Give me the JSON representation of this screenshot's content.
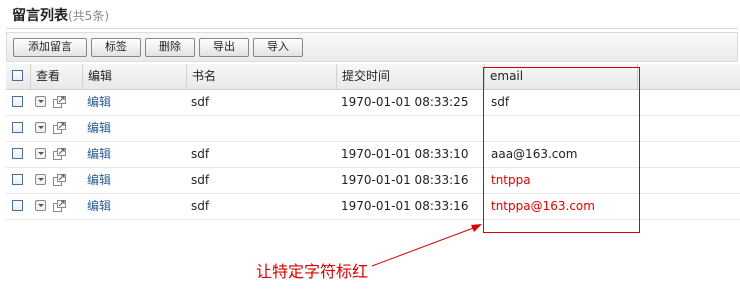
{
  "header": {
    "title": "留言列表",
    "count": "(共5条)"
  },
  "toolbar": {
    "add": "添加留言",
    "tag": "标签",
    "delete": "删除",
    "export": "导出",
    "import": "导入"
  },
  "table": {
    "columns": {
      "view": "查看",
      "edit": "编辑",
      "book": "书名",
      "time": "提交时间",
      "email": "email"
    },
    "rows": [
      {
        "edit": "编辑",
        "book": "sdf",
        "time": "1970-01-01 08:33:25",
        "email": "sdf",
        "highlight": false
      },
      {
        "edit": "编辑",
        "book": "",
        "time": "",
        "email": "",
        "highlight": false
      },
      {
        "edit": "编辑",
        "book": "sdf",
        "time": "1970-01-01 08:33:10",
        "email": "aaa@163.com",
        "highlight": false
      },
      {
        "edit": "编辑",
        "book": "sdf",
        "time": "1970-01-01 08:33:16",
        "email": "tntppa",
        "highlight": true
      },
      {
        "edit": "编辑",
        "book": "sdf",
        "time": "1970-01-01 08:33:16",
        "email": "tntppa@163.com",
        "highlight": true
      }
    ]
  },
  "annotation": {
    "text": "让特定字符标红",
    "color": "#d80000"
  },
  "colors": {
    "link": "#2a5d96",
    "highlight": "#e00000"
  }
}
